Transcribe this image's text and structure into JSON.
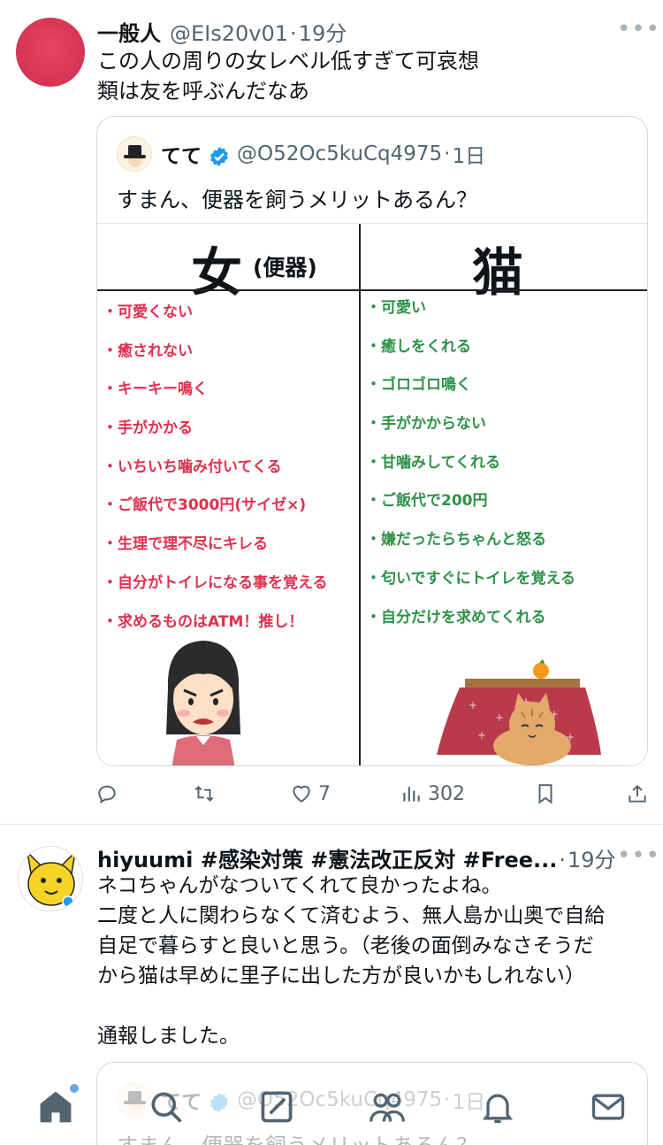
{
  "tweet1": {
    "display_name": "一般人",
    "handle": "@EIs20v01",
    "dot": "·",
    "time": "19分",
    "more": "•••",
    "text_lines": [
      "この人の周りの女レベル低すぎて可哀想",
      "類は友を呼ぶんだなあ"
    ],
    "quote": {
      "display_name": "てて",
      "handle": "@O52Oc5kuCq4975",
      "dot": "·",
      "time": "1日",
      "text": "すまん、便器を飼うメリットあるん？",
      "image": {
        "left_heading": "女",
        "left_heading_sub": "(便器)",
        "right_heading": "猫",
        "left_items": [
          "・可愛くない",
          "・癒されない",
          "・キーキー鳴く",
          "・手がかかる",
          "・いちいち噛み付いてくる",
          "・ご飯代で3000円(サイゼ×)",
          "・生理で理不尽にキレる",
          "・自分がトイレになる事を覚える",
          "・求めるものはATM！推し！"
        ],
        "right_items": [
          "・可愛い",
          "・癒しをくれる",
          "・ゴロゴロ鳴く",
          "・手がかからない",
          "・甘噛みしてくれる",
          "・ご飯代で200円",
          "・嫌だったらちゃんと怒る",
          "・匂いですぐにトイレを覚える",
          "・自分だけを求めてくれる"
        ]
      }
    },
    "actions": {
      "reply_count": "",
      "retweet_count": "",
      "like_count": "7",
      "views_count": "302"
    }
  },
  "tweet2": {
    "display_name": "hiyuumi #感染対策 #憲法改正反対 #Free...",
    "dot": "·",
    "time": "19分",
    "more": "•••",
    "text_lines": [
      "ネコちゃんがなついてくれて良かったよね。",
      "二度と人に関わらなくて済むよう、無人島か山奥で自給",
      "自足で暮らすと良いと思う。（老後の面倒みなさそうだ",
      "から猫は早めに里子に出した方が良いかもしれない）",
      "",
      "通報しました。"
    ],
    "quote": {
      "display_name": "てて",
      "handle": "@O52Oc5kuCq4975",
      "dot": "·",
      "time": "1日",
      "text": "すまん、便器を飼うメリットあるん？"
    }
  },
  "colors": {
    "accent": "#1d9bf0",
    "left_list": "#e0304d",
    "right_list": "#2e9248"
  },
  "tabbar": {
    "items": [
      "home-icon",
      "search-icon",
      "compose-icon",
      "communities-icon",
      "notifications-icon",
      "messages-icon"
    ]
  }
}
